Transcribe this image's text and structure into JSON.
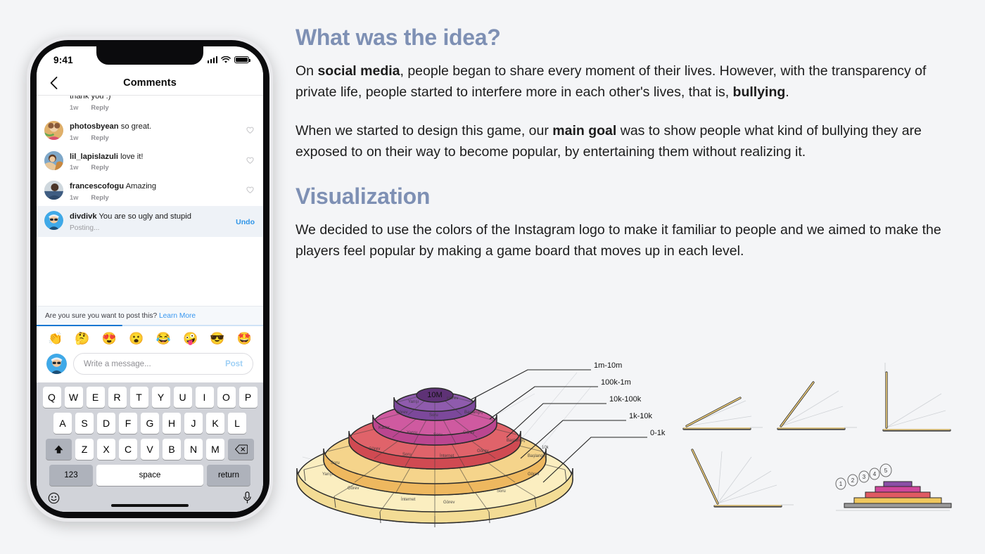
{
  "phone": {
    "status": {
      "time": "9:41",
      "signal_icon": "signal-bars-icon",
      "wifi_icon": "wifi-icon",
      "battery_icon": "battery-icon"
    },
    "nav": {
      "back_icon": "chevron-left-icon",
      "title": "Comments"
    },
    "comments": [
      {
        "username": "",
        "text": "thank you :)",
        "time": "1w",
        "reply": "Reply",
        "clipped": true,
        "liked_icon": "heart-icon"
      },
      {
        "username": "photosbyean",
        "text": "so great.",
        "time": "1w",
        "reply": "Reply",
        "clipped": false,
        "liked_icon": "heart-icon"
      },
      {
        "username": "lil_lapislazuli",
        "text": "love it!",
        "time": "1w",
        "reply": "Reply",
        "clipped": false,
        "liked_icon": "heart-icon"
      },
      {
        "username": "francescofogu",
        "text": "Amazing",
        "time": "1w",
        "reply": "Reply",
        "clipped": false,
        "liked_icon": "heart-icon"
      }
    ],
    "pending_comment": {
      "username": "divdivk",
      "text": "You are so ugly and stupid",
      "status": "Posting...",
      "undo_label": "Undo"
    },
    "warning": {
      "text": "Are you sure you want to post this?",
      "link_label": "Learn More",
      "progress_percent": 38
    },
    "quick_emojis": [
      "👏",
      "🤔",
      "😍",
      "😮",
      "😂",
      "🤪",
      "😎",
      "🤩"
    ],
    "composer": {
      "placeholder": "Write a message...",
      "post_label": "Post",
      "avatar_icon": "user-avatar-icon"
    },
    "keyboard": {
      "row1": [
        "Q",
        "W",
        "E",
        "R",
        "T",
        "Y",
        "U",
        "I",
        "O",
        "P"
      ],
      "row2": [
        "A",
        "S",
        "D",
        "F",
        "G",
        "H",
        "J",
        "K",
        "L"
      ],
      "row3": [
        "Z",
        "X",
        "C",
        "V",
        "B",
        "N",
        "M"
      ],
      "shift_icon": "shift-arrow-icon",
      "backspace_icon": "backspace-icon",
      "numbers_label": "123",
      "space_label": "space",
      "return_label": "return",
      "emoji_icon": "smiley-face-icon",
      "mic_icon": "microphone-icon"
    }
  },
  "content": {
    "heading_1": "What was the idea?",
    "paragraph_1": {
      "parts": [
        {
          "text": "On ",
          "bold": false
        },
        {
          "text": "social media",
          "bold": true
        },
        {
          "text": ", people began to share every moment of their lives. However, with the transparency of private life, people started to interfere more in each other's lives, that is, ",
          "bold": false
        },
        {
          "text": "bullying",
          "bold": true
        },
        {
          "text": ".",
          "bold": false
        }
      ]
    },
    "paragraph_2": {
      "parts": [
        {
          "text": "When we started to design this game, our ",
          "bold": false
        },
        {
          "text": "main goal",
          "bold": true
        },
        {
          "text": " was to show people what kind of bullying they are exposed to on their way to become popular, by entertaining them without realizing it.",
          "bold": false
        }
      ]
    },
    "heading_2": "Visualization",
    "paragraph_3": {
      "parts": [
        {
          "text": "We decided to use the colors of the Instagram logo to make it familiar to people and we aimed to make the players feel popular by making a game board that moves up in each level.",
          "bold": false
        }
      ]
    }
  },
  "sketches": {
    "board_center_label": "10M",
    "tier_labels": [
      "1m-10m",
      "100k-1m",
      "10k-100k",
      "1k-10k",
      "0-1k"
    ],
    "tier_colors": [
      "#8b5aa8",
      "#c9539b",
      "#d64a55",
      "#eda14f",
      "#f6dfa0"
    ],
    "tile_words": [
      "Yarışı",
      "Soru",
      "Görev",
      "İnternet Trolü",
      "Başlangıç",
      "Kader"
    ],
    "ring_value_labels": [
      "1m",
      "100k",
      "10k",
      "1k"
    ],
    "step_numbers": [
      "1",
      "2",
      "3",
      "4",
      "5"
    ],
    "step_colors": [
      "#9a9a9a",
      "#f0c85e",
      "#e05a62",
      "#d0479b",
      "#8b4fa6"
    ],
    "hinge_count": 4
  }
}
